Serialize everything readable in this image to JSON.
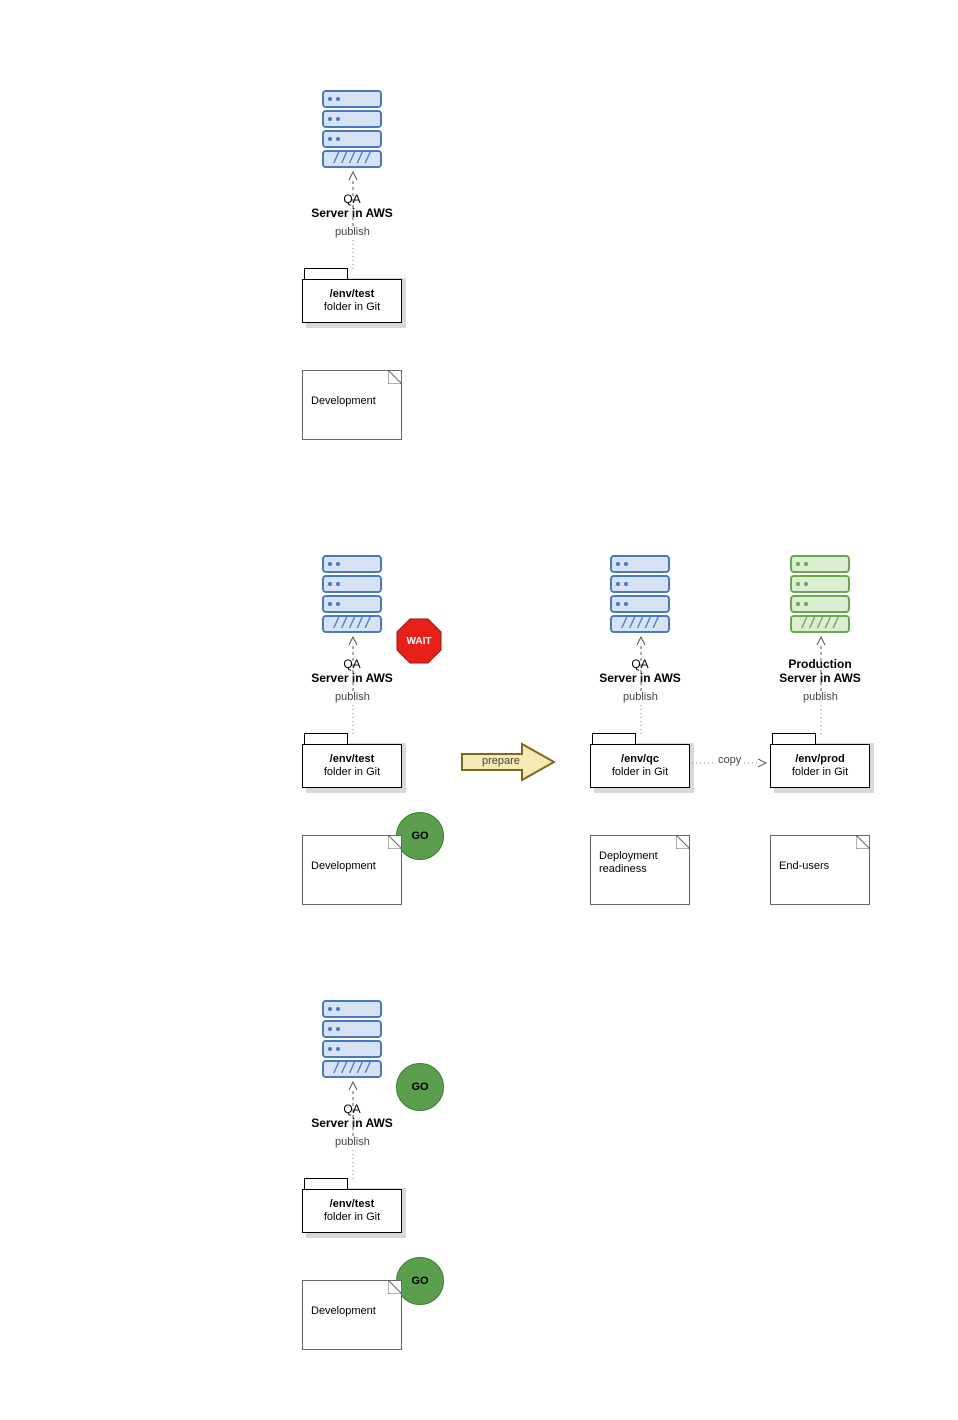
{
  "servers": {
    "qa": {
      "title": "QA",
      "subtitle": "Server in AWS"
    },
    "prod": {
      "title": "Production",
      "subtitle": "Server in AWS"
    }
  },
  "labels": {
    "publish": "publish",
    "copy": "copy",
    "prepare": "prepare"
  },
  "folders": {
    "test": {
      "line1": "/env/test",
      "line2": "folder in Git"
    },
    "qc": {
      "line1": "/env/qc",
      "line2": "folder in Git"
    },
    "prod": {
      "line1": "/env/prod",
      "line2": "folder in Git"
    }
  },
  "notes": {
    "development": "Development",
    "deploy_ready": "Deployment readiness",
    "end_users": "End-users"
  },
  "badges": {
    "wait": "WAIT",
    "go": "GO"
  },
  "glyph": {
    "vents": "/////"
  }
}
